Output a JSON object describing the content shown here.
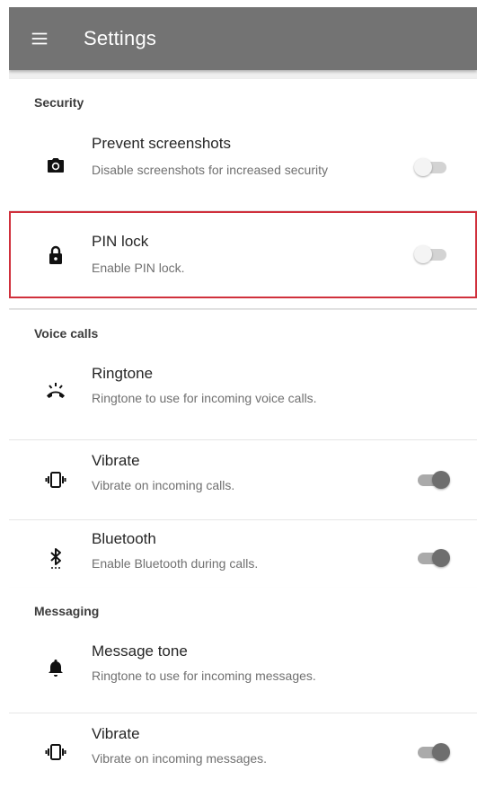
{
  "appbar": {
    "title": "Settings",
    "menu_icon": "hamburger-menu-icon"
  },
  "sections": {
    "security": {
      "header": "Security",
      "prevent_screenshots": {
        "title": "Prevent screenshots",
        "subtitle": "Disable screenshots for increased security",
        "icon": "camera-icon",
        "enabled": false
      },
      "pin_lock": {
        "title": "PIN lock",
        "subtitle": "Enable PIN lock.",
        "icon": "lock-icon",
        "enabled": false
      }
    },
    "voice_calls": {
      "header": "Voice calls",
      "ringtone": {
        "title": "Ringtone",
        "subtitle": "Ringtone to use for incoming voice calls.",
        "icon": "ringing-phone-icon"
      },
      "vibrate": {
        "title": "Vibrate",
        "subtitle": "Vibrate on incoming calls.",
        "icon": "vibrate-icon",
        "enabled": true
      },
      "bluetooth": {
        "title": "Bluetooth",
        "subtitle": "Enable Bluetooth during calls.",
        "icon": "bluetooth-searching-icon",
        "enabled": true
      }
    },
    "messaging": {
      "header": "Messaging",
      "message_tone": {
        "title": "Message tone",
        "subtitle": "Ringtone to use for incoming messages.",
        "icon": "bell-icon"
      },
      "vibrate": {
        "title": "Vibrate",
        "subtitle": "Vibrate on incoming messages.",
        "icon": "vibrate-icon",
        "enabled": true
      }
    }
  },
  "colors": {
    "appbar": "#737373",
    "highlight_border": "#d0303c",
    "background": "#efefef"
  }
}
